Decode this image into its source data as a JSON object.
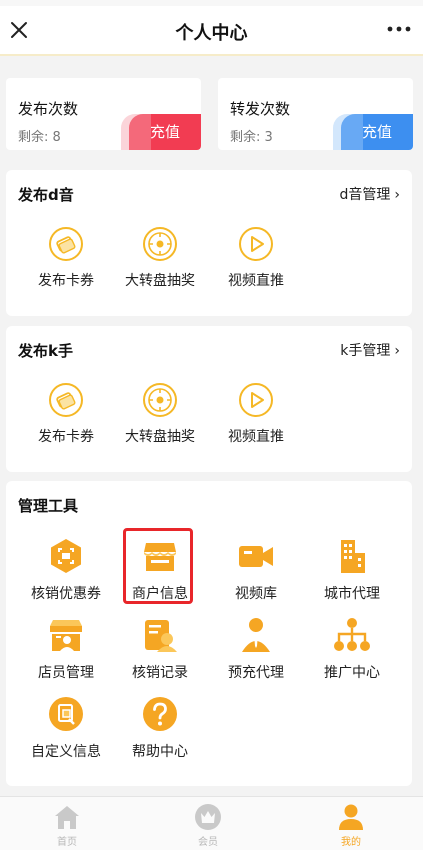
{
  "header": {
    "title": "个人中心",
    "close_icon": "close-icon",
    "more_icon": "more-icon"
  },
  "recharge_cards": [
    {
      "name": "发布次数",
      "remaining": "剩余: 8",
      "button": "充值",
      "color": "#f23c52"
    },
    {
      "name": "转发次数",
      "remaining": "剩余: 3",
      "button": "充值",
      "color": "#3d8ff0"
    }
  ],
  "publish_d": {
    "title": "发布d音",
    "manage_link": "d音管理",
    "items": [
      {
        "label": "发布卡券",
        "icon": "coupon-icon"
      },
      {
        "label": "大转盘抽奖",
        "icon": "wheel-icon"
      },
      {
        "label": "视频直推",
        "icon": "play-icon"
      }
    ]
  },
  "publish_k": {
    "title": "发布k手",
    "manage_link": "k手管理",
    "items": [
      {
        "label": "发布卡券",
        "icon": "coupon-icon"
      },
      {
        "label": "大转盘抽奖",
        "icon": "wheel-icon"
      },
      {
        "label": "视频直推",
        "icon": "play-icon"
      }
    ]
  },
  "tools": {
    "title": "管理工具",
    "items": [
      {
        "label": "核销优惠券",
        "icon": "scan-coupon-icon"
      },
      {
        "label": "商户信息",
        "icon": "shop-icon",
        "highlighted": true
      },
      {
        "label": "视频库",
        "icon": "video-camera-icon"
      },
      {
        "label": "城市代理",
        "icon": "city-building-icon"
      },
      {
        "label": "店员管理",
        "icon": "staff-icon"
      },
      {
        "label": "核销记录",
        "icon": "record-icon"
      },
      {
        "label": "预充代理",
        "icon": "agent-icon"
      },
      {
        "label": "推广中心",
        "icon": "network-icon"
      },
      {
        "label": "自定义信息",
        "icon": "custom-info-icon"
      },
      {
        "label": "帮助中心",
        "icon": "help-icon"
      }
    ]
  },
  "tabbar": [
    {
      "label": "首页",
      "icon": "home-icon",
      "active": false
    },
    {
      "label": "会员",
      "icon": "member-icon",
      "active": false
    },
    {
      "label": "我的",
      "icon": "profile-icon",
      "active": true
    }
  ],
  "colors": {
    "accent": "#f5a623",
    "highlight_border": "#e8262a",
    "recharge_red": "#f23c52",
    "recharge_blue": "#3d8ff0"
  }
}
